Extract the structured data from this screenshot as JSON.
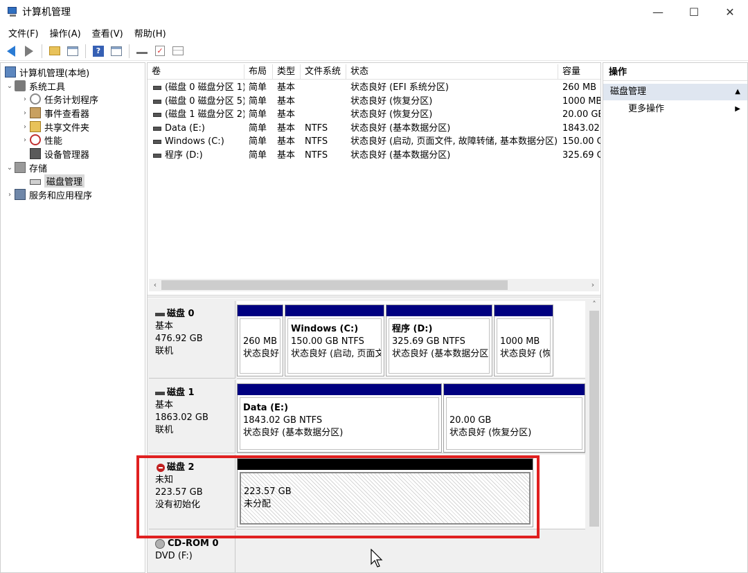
{
  "window": {
    "title": "计算机管理",
    "minimize": "—",
    "maximize": "☐",
    "close": "✕"
  },
  "menu": [
    "文件(F)",
    "操作(A)",
    "查看(V)",
    "帮助(H)"
  ],
  "toolbar_icons": [
    "back-arrow-icon",
    "forward-arrow-icon",
    "folder-up-icon",
    "show-hide-tree-icon",
    "help-icon",
    "show-hide-action-pane-icon",
    "key-icon",
    "checklist-icon",
    "properties-icon"
  ],
  "tree": {
    "root": "计算机管理(本地)",
    "system_tools": "系统工具",
    "task_scheduler": "任务计划程序",
    "event_viewer": "事件查看器",
    "shared_folders": "共享文件夹",
    "performance": "性能",
    "device_manager": "设备管理器",
    "storage": "存储",
    "disk_management": "磁盘管理",
    "services": "服务和应用程序"
  },
  "volumes": {
    "columns": [
      "卷",
      "布局",
      "类型",
      "文件系统",
      "状态",
      "容量"
    ],
    "rows": [
      {
        "name": "(磁盘 0 磁盘分区 1)",
        "layout": "简单",
        "type": "基本",
        "fs": "",
        "status": "状态良好 (EFI 系统分区)",
        "capacity": "260 MB"
      },
      {
        "name": "(磁盘 0 磁盘分区 5)",
        "layout": "简单",
        "type": "基本",
        "fs": "",
        "status": "状态良好 (恢复分区)",
        "capacity": "1000 MB"
      },
      {
        "name": "(磁盘 1 磁盘分区 2)",
        "layout": "简单",
        "type": "基本",
        "fs": "",
        "status": "状态良好 (恢复分区)",
        "capacity": "20.00 GB"
      },
      {
        "name": "Data (E:)",
        "layout": "简单",
        "type": "基本",
        "fs": "NTFS",
        "status": "状态良好 (基本数据分区)",
        "capacity": "1843.02"
      },
      {
        "name": "Windows (C:)",
        "layout": "简单",
        "type": "基本",
        "fs": "NTFS",
        "status": "状态良好 (启动, 页面文件, 故障转储, 基本数据分区)",
        "capacity": "150.00 G"
      },
      {
        "name": "程序 (D:)",
        "layout": "简单",
        "type": "基本",
        "fs": "NTFS",
        "status": "状态良好 (基本数据分区)",
        "capacity": "325.69 G"
      }
    ]
  },
  "disks": {
    "disk0": {
      "name": "磁盘 0",
      "type": "基本",
      "size": "476.92 GB",
      "state": "联机",
      "p1": {
        "size": "260 MB",
        "status": "状态良好"
      },
      "p2": {
        "title": "Windows  (C:)",
        "size": "150.00 GB NTFS",
        "status": "状态良好 (启动, 页面文"
      },
      "p3": {
        "title": "程序  (D:)",
        "size": "325.69 GB NTFS",
        "status": "状态良好 (基本数据分区"
      },
      "p4": {
        "size": "1000 MB",
        "status": "状态良好 (恢"
      }
    },
    "disk1": {
      "name": "磁盘 1",
      "type": "基本",
      "size": "1863.02 GB",
      "state": "联机",
      "p1": {
        "title": "Data  (E:)",
        "size": "1843.02 GB NTFS",
        "status": "状态良好 (基本数据分区)"
      },
      "p2": {
        "size": "20.00 GB",
        "status": "状态良好 (恢复分区)"
      }
    },
    "disk2": {
      "name": "磁盘 2",
      "type": "未知",
      "size": "223.57 GB",
      "state": "没有初始化",
      "p1": {
        "size": "223.57 GB",
        "status": "未分配"
      }
    },
    "cdrom": {
      "name": "CD-ROM 0",
      "type": "DVD (F:)"
    }
  },
  "actions": {
    "header": "操作",
    "group": "磁盘管理",
    "more": "更多操作"
  },
  "colors": {
    "partition_bar": "#000080",
    "unallocated_bar": "#000000",
    "highlight": "#e02020",
    "action_group_bg": "#dfe6f0"
  }
}
